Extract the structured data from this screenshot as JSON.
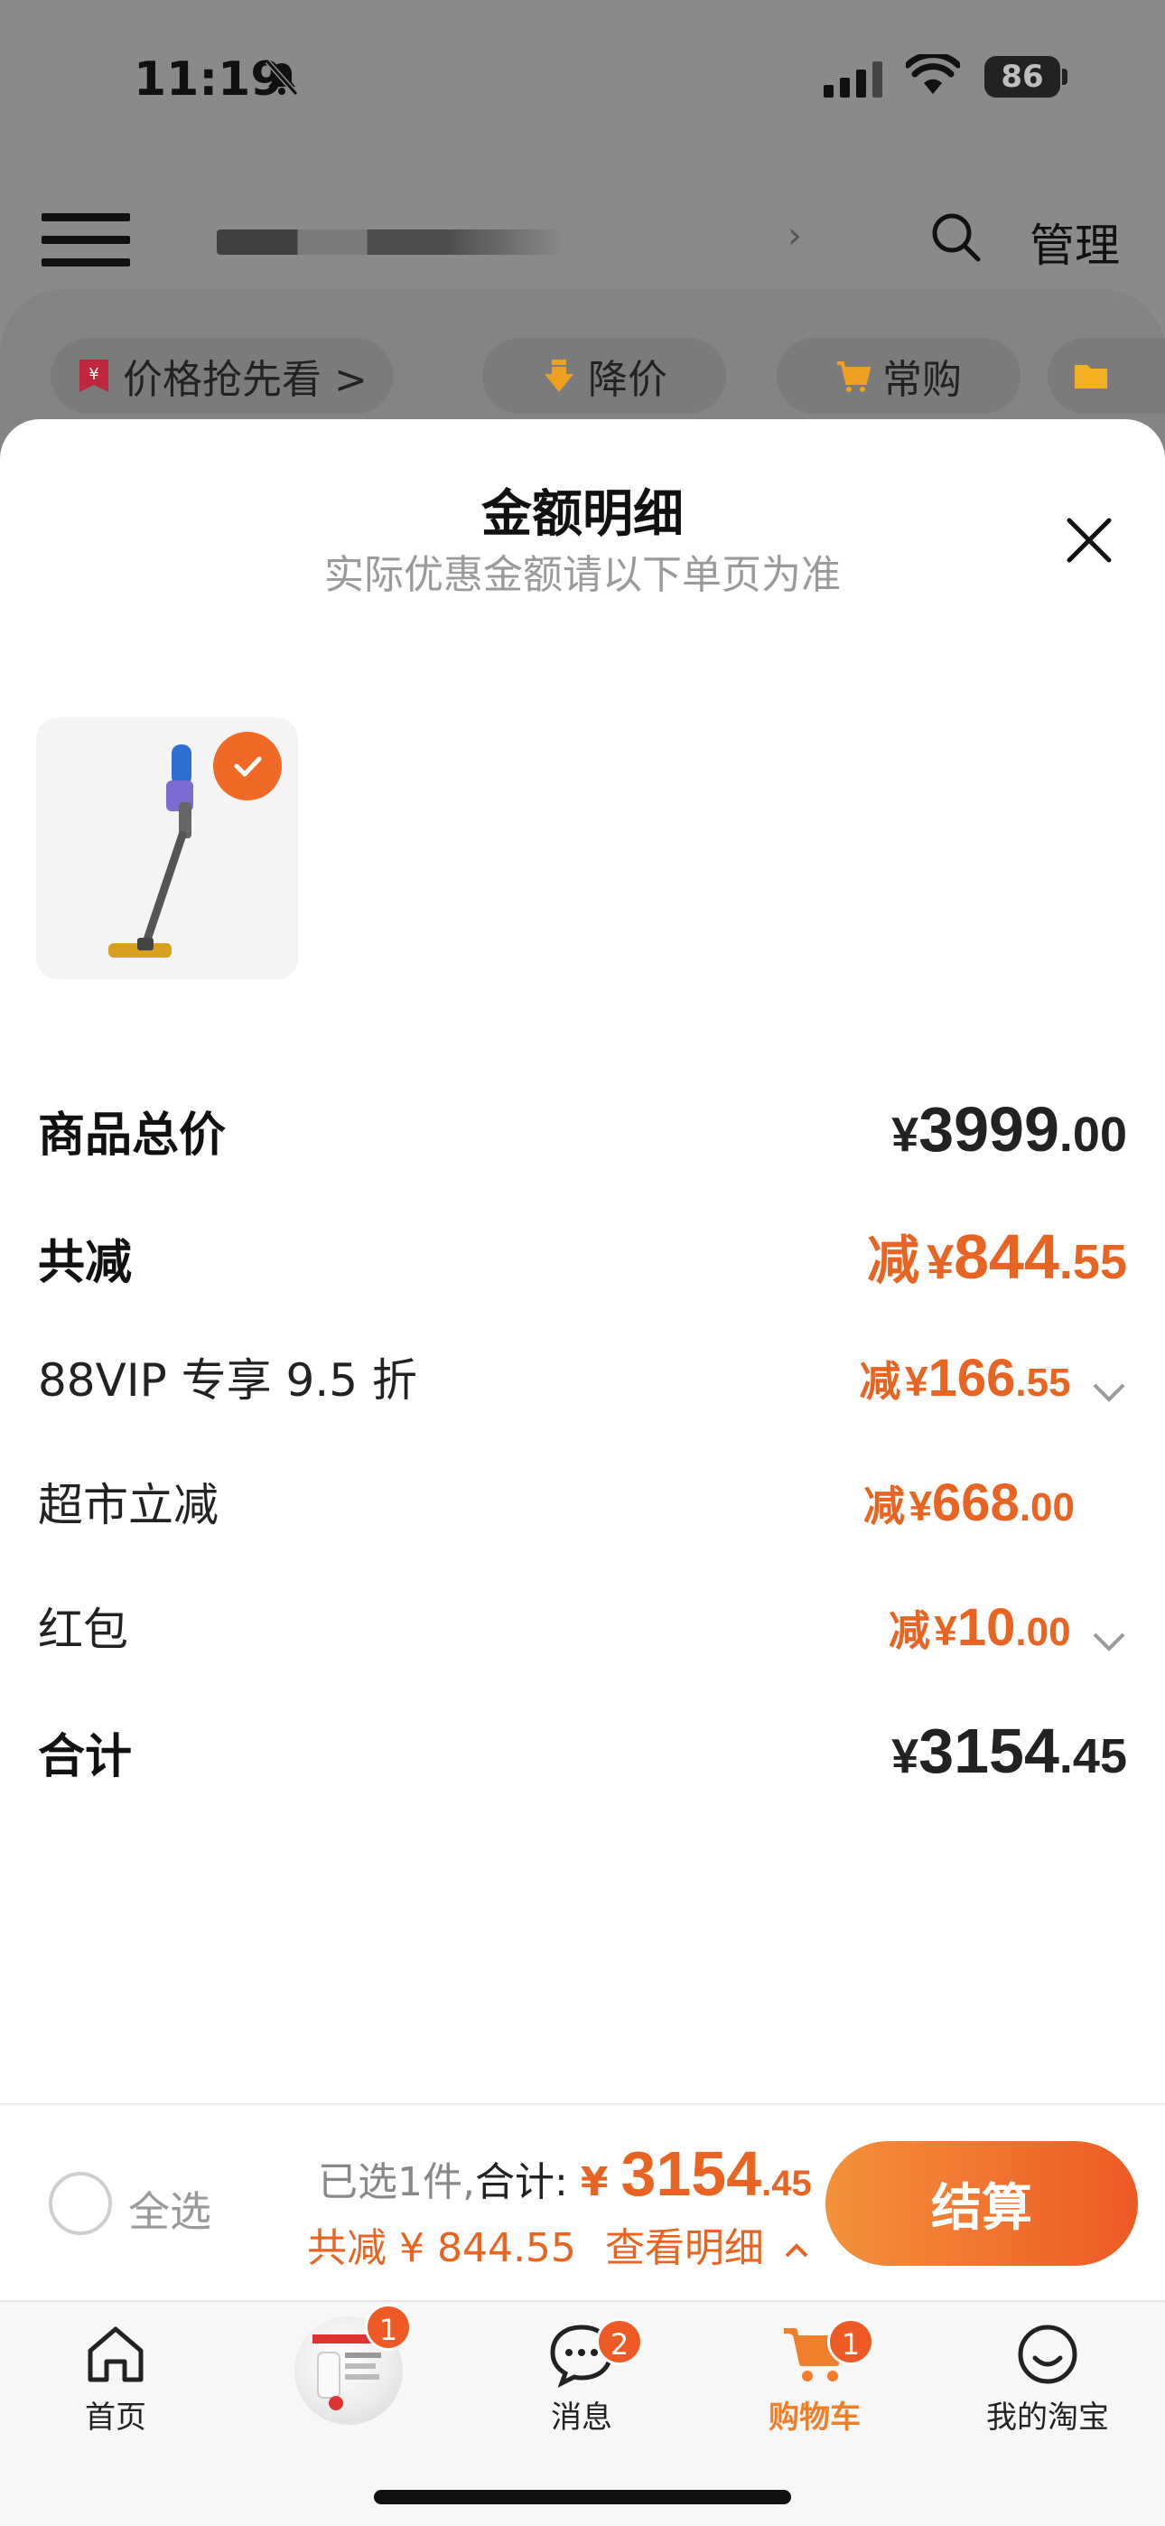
{
  "status_bar": {
    "time": "11:19",
    "battery": "86"
  },
  "header": {
    "manage_label": "管理"
  },
  "chips": [
    {
      "label": "价格抢先看 >",
      "icon": "price-tag-icon",
      "color": "#c0273d"
    },
    {
      "label": "降价",
      "icon": "down-arrow-icon",
      "color": "#f0a020"
    },
    {
      "label": "常购",
      "icon": "cart-icon",
      "color": "#f0a020"
    },
    {
      "label": "",
      "icon": "folder-icon",
      "color": "#f0b020"
    }
  ],
  "sheet": {
    "title": "金额明细",
    "subtitle": "实际优惠金额请以下单页为准",
    "rows": [
      {
        "label": "商品总价",
        "prefix": "",
        "currency": "¥",
        "int": "3999",
        "dec": ".00",
        "style": "black-big",
        "strong": true,
        "chevron": false
      },
      {
        "label": "共减",
        "prefix": "减",
        "currency": "¥",
        "int": "844",
        "dec": ".55",
        "style": "orange-big",
        "strong": true,
        "chevron": false
      },
      {
        "label": "88VIP 专享 9.5 折",
        "prefix": "减",
        "currency": "¥",
        "int": "166",
        "dec": ".55",
        "style": "orange-small",
        "strong": false,
        "chevron": true
      },
      {
        "label": "超市立减",
        "prefix": "减",
        "currency": "¥",
        "int": "668",
        "dec": ".00",
        "style": "orange-small",
        "strong": false,
        "chevron": false
      },
      {
        "label": "红包",
        "prefix": "减",
        "currency": "¥",
        "int": "10",
        "dec": ".00",
        "style": "orange-small",
        "strong": false,
        "chevron": true
      },
      {
        "label": "合计",
        "prefix": "",
        "currency": "¥",
        "int": "3154",
        "dec": ".45",
        "style": "black-big",
        "strong": true,
        "chevron": false
      }
    ]
  },
  "checkout": {
    "select_all": "全选",
    "selected_count": "已选1件,",
    "total_label": "合计:",
    "total_currency": "¥",
    "total_int": "3154",
    "total_dec": ".45",
    "discount_text": "共减 ¥ 844.55",
    "detail_link": "查看明细",
    "checkout_button": "结算"
  },
  "tabs": [
    {
      "label": "首页",
      "icon": "home-icon",
      "badge": ""
    },
    {
      "label": "",
      "icon": "promo-thumbnail",
      "badge": "1"
    },
    {
      "label": "消息",
      "icon": "message-icon",
      "badge": "2"
    },
    {
      "label": "购物车",
      "icon": "cart-icon",
      "badge": "1",
      "active": true
    },
    {
      "label": "我的淘宝",
      "icon": "profile-icon",
      "badge": ""
    }
  ],
  "colors": {
    "accent": "#e86423",
    "checkout_start": "#f3913a",
    "checkout_end": "#ee5a24"
  }
}
